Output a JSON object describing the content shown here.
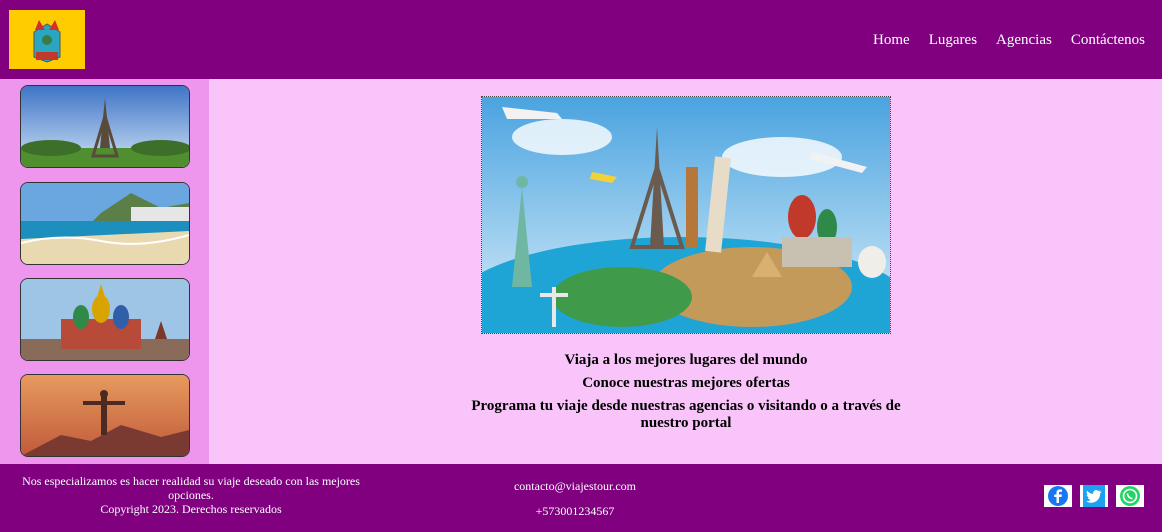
{
  "nav": [
    "Home",
    "Lugares",
    "Agencias",
    "Contáctenos"
  ],
  "sidebar_thumbs": [
    "eiffel-tower-thumbnail",
    "beach-thumbnail",
    "saint-basil-cathedral-thumbnail",
    "christ-redeemer-thumbnail"
  ],
  "main": {
    "lines": [
      "Viaja a los mejores lugares del mundo",
      "Conoce nuestras mejores ofertas",
      "Programa tu viaje desde nuestras agencias o visitando o a través de nuestro portal"
    ]
  },
  "footer": {
    "tagline": "Nos especializamos es hacer realidad su viaje deseado con las mejores opciones.",
    "copyright": "Copyright 2023. Derechos reservados",
    "email": "contacto@viajestour.com",
    "phone": "+573001234567",
    "social": [
      "facebook-icon",
      "twitter-icon",
      "whatsapp-icon"
    ]
  },
  "colors": {
    "header": "#800080",
    "sidebar": "#ee96ee",
    "content": "#f9c4f9",
    "logo_bg": "#ffcc00"
  }
}
